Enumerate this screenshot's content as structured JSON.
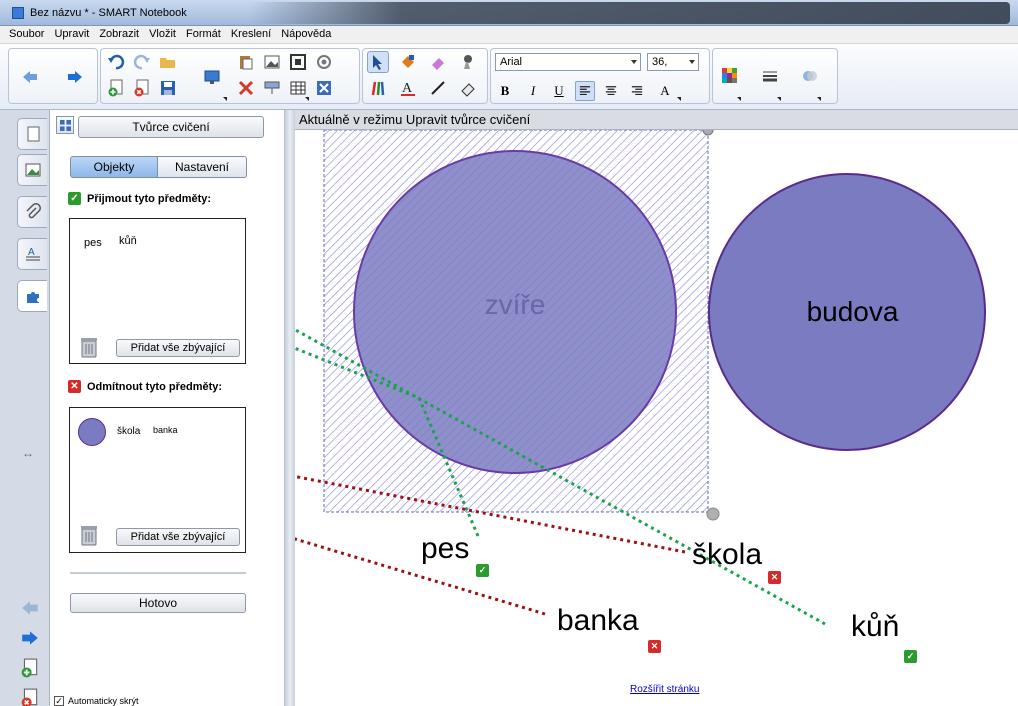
{
  "window": {
    "title": "Bez názvu * - SMART Notebook"
  },
  "menu": [
    "Soubor",
    "Upravit",
    "Zobrazit",
    "Vložit",
    "Formát",
    "Kreslení",
    "Nápověda"
  ],
  "toolbar": {
    "font_name": "Arial",
    "font_size": "36,",
    "bold": "B",
    "italic": "I",
    "underline": "U",
    "text_color_glyph": "A"
  },
  "panel": {
    "title": "Tvůrce cvičení",
    "tabs": {
      "objects": "Objekty",
      "settings": "Nastavení"
    },
    "accept": {
      "header": "Přijmout tyto předměty:",
      "items": [
        "pes",
        "kůň"
      ],
      "add_remaining": "Přidat vše zbývající"
    },
    "reject": {
      "header": "Odmítnout tyto předměty:",
      "items": [
        "škola",
        "banka"
      ],
      "add_remaining": "Přidat vše zbývající"
    },
    "done": "Hotovo",
    "autohide": "Automaticky skrýt"
  },
  "canvas": {
    "mode_text": "Aktuálně v režimu Upravit tvůrce cvičení",
    "zone_label": "zvíře",
    "circle_label": "budova",
    "words": {
      "pes": "pes",
      "skola": "škola",
      "kun": "kůň",
      "banka": "banka"
    },
    "extend_page": "Rozšířit stránku"
  },
  "colors": {
    "circle_fill": "#7b7bc2",
    "circle_stroke": "#5a2a8e",
    "hatch": "#8d8ae0",
    "accept_green": "#2d9a2d",
    "reject_red": "#d42a2a",
    "arrow_green": "#1aa34a",
    "arrow_red": "#a01010",
    "link": "#0000cc"
  },
  "icons": [
    "undo-icon",
    "redo-icon",
    "open-icon",
    "new-page-icon",
    "delete-page-icon",
    "save-icon",
    "screen-shade-icon",
    "paste-icon",
    "full-screen-icon",
    "delete-icon",
    "table-icon",
    "select-icon",
    "pen-icon",
    "eraser-icon",
    "line-icon",
    "shapes-icon",
    "text-icon",
    "fill-icon",
    "properties-icon"
  ]
}
